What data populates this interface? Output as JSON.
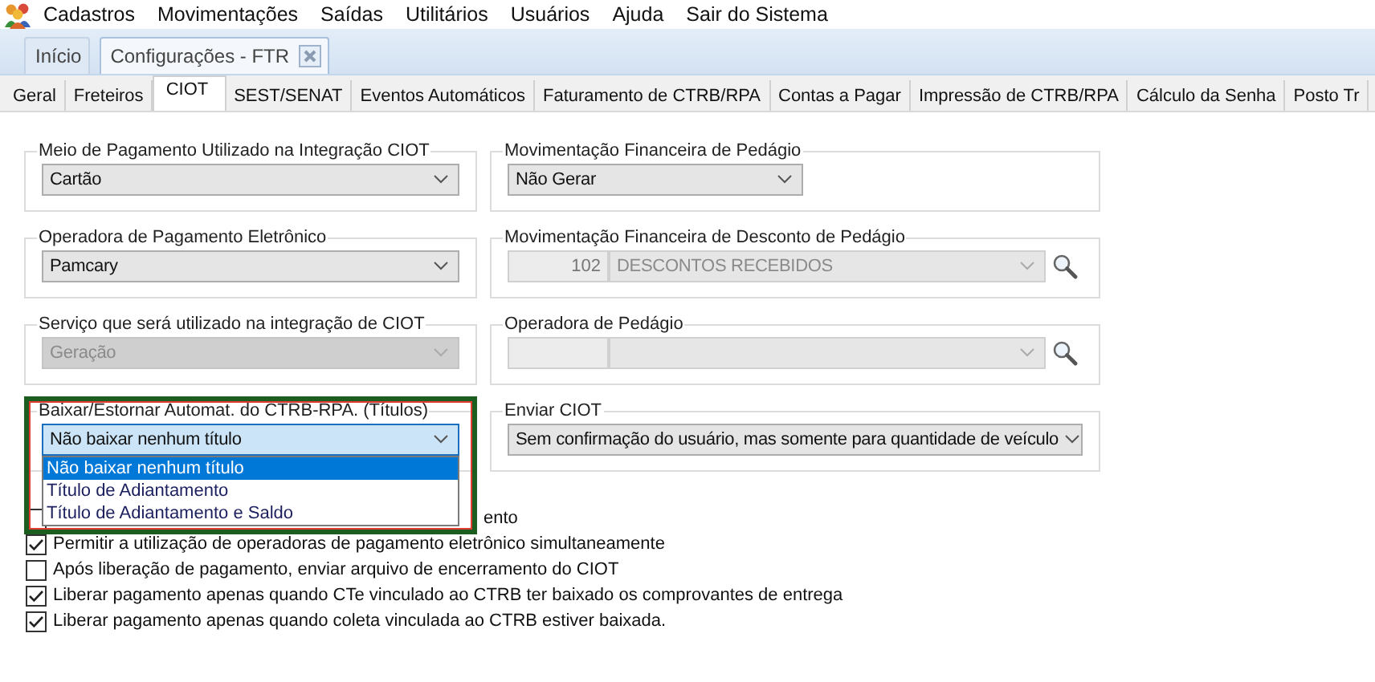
{
  "menu": {
    "items": [
      {
        "label": "Cadastros"
      },
      {
        "label": "Movimentações"
      },
      {
        "label": "Saídas"
      },
      {
        "label": "Utilitários"
      },
      {
        "label": "Usuários"
      },
      {
        "label": "Ajuda"
      },
      {
        "label": "Sair do Sistema"
      }
    ]
  },
  "document_tabs": [
    {
      "label": "Início",
      "selected": false,
      "closable": false
    },
    {
      "label": "Configurações - FTR",
      "selected": true,
      "closable": true
    }
  ],
  "tabs": [
    {
      "label": "Geral",
      "selected": false
    },
    {
      "label": "Freteiros",
      "selected": false
    },
    {
      "label": "CIOT",
      "selected": true
    },
    {
      "label": "SEST/SENAT",
      "selected": false
    },
    {
      "label": "Eventos Automáticos",
      "selected": false
    },
    {
      "label": "Faturamento de CTRB/RPA",
      "selected": false
    },
    {
      "label": "Contas a Pagar",
      "selected": false
    },
    {
      "label": "Impressão de CTRB/RPA",
      "selected": false
    },
    {
      "label": "Cálculo da Senha",
      "selected": false
    },
    {
      "label": "Posto Tr",
      "selected": false
    }
  ],
  "left_groups": [
    {
      "legend": "Meio de Pagamento Utilizado na Integração CIOT",
      "kind": "combo",
      "value": "Cartão",
      "disabled": false,
      "focused": false
    },
    {
      "legend": "Operadora de Pagamento Eletrônico",
      "kind": "combo",
      "value": "Pamcary",
      "disabled": false,
      "focused": false
    },
    {
      "legend": "Serviço que será utilizado na integração de CIOT",
      "kind": "combo",
      "value": "Geração",
      "disabled": true,
      "focused": false
    },
    {
      "legend": "Baixar/Estornar Automat. do CTRB-RPA. (Títulos)",
      "kind": "combo",
      "value": "Não baixar nenhum título",
      "disabled": false,
      "focused": true,
      "highlighted": true,
      "options": [
        {
          "label": "Não baixar nenhum título",
          "selected": true
        },
        {
          "label": "Título de Adiantamento",
          "selected": false
        },
        {
          "label": "Título de Adiantamento e Saldo",
          "selected": false
        }
      ]
    }
  ],
  "right_groups": [
    {
      "legend": "Movimentação Financeira de Pedágio",
      "kind": "short_combo",
      "value": "Não Gerar",
      "disabled": false
    },
    {
      "legend": "Movimentação Financeira de Desconto de  Pedágio",
      "kind": "lookup",
      "code": "102",
      "value": "DESCONTOS RECEBIDOS",
      "disabled": true
    },
    {
      "legend": "Operadora de Pedágio",
      "kind": "lookup",
      "disabled": true
    },
    {
      "legend": "Enviar CIOT",
      "kind": "combo",
      "value": "Sem confirmação do usuário, mas somente para quantidade de veículo",
      "disabled": false
    }
  ],
  "checkboxes": [
    {
      "label": "ento",
      "checked": false,
      "covered": true
    },
    {
      "label": "Permitir a utilização de operadoras de pagamento eletrônico simultaneamente",
      "checked": true
    },
    {
      "label": "Após liberação de pagamento, enviar arquivo de encerramento do CIOT",
      "checked": false
    },
    {
      "label": "Liberar pagamento apenas quando CTe vinculado ao CTRB ter baixado os comprovantes de entrega",
      "checked": true
    },
    {
      "label": "Liberar pagamento apenas quando coleta vinculada ao CTRB estiver baixada.",
      "checked": true
    }
  ]
}
